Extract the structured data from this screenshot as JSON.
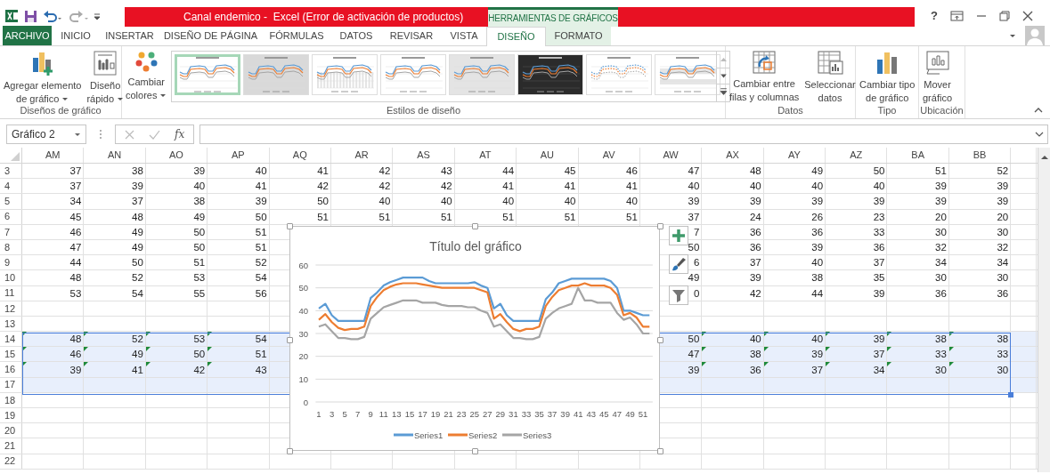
{
  "window": {
    "title": "Canal endemico -  Excel (Error de activación de productos)",
    "context_label": "HERRAMIENTAS DE GRÁFICOS",
    "help": "?"
  },
  "tabs": [
    {
      "label": "ARCHIVO",
      "kind": "file",
      "selected": false
    },
    {
      "label": "INICIO",
      "kind": "normal",
      "selected": false
    },
    {
      "label": "INSERTAR",
      "kind": "normal",
      "selected": false
    },
    {
      "label": "DISEÑO DE PÁGINA",
      "kind": "normal",
      "selected": false
    },
    {
      "label": "FÓRMULAS",
      "kind": "normal",
      "selected": false
    },
    {
      "label": "DATOS",
      "kind": "normal",
      "selected": false
    },
    {
      "label": "REVISAR",
      "kind": "normal",
      "selected": false
    },
    {
      "label": "VISTA",
      "kind": "normal",
      "selected": false
    },
    {
      "label": "DISEÑO",
      "kind": "context",
      "selected": true
    },
    {
      "label": "FORMATO",
      "kind": "context",
      "selected": false
    }
  ],
  "ribbon": {
    "groups": [
      {
        "label": "Diseños de gráfico",
        "buttons": [
          {
            "lines": [
              "Agregar elemento",
              "de gráfico"
            ],
            "dropdown": true
          },
          {
            "lines": [
              "Diseño",
              "rápido"
            ],
            "dropdown": true
          }
        ]
      },
      {
        "label": "Estilos de diseño",
        "buttons": [
          {
            "lines": [
              "Cambiar",
              "colores"
            ],
            "dropdown": true
          }
        ],
        "gallery": [
          {
            "kind": "plain",
            "selected": true
          },
          {
            "kind": "shaded",
            "selected": false
          },
          {
            "kind": "columns",
            "selected": false
          },
          {
            "kind": "plain",
            "selected": false
          },
          {
            "kind": "hatched",
            "selected": false
          },
          {
            "kind": "dark",
            "selected": false
          },
          {
            "kind": "markers",
            "selected": false
          },
          {
            "kind": "banded",
            "selected": false
          }
        ]
      },
      {
        "label": "Datos",
        "buttons": [
          {
            "lines": [
              "Cambiar entre",
              "filas y columnas"
            ],
            "dropdown": false
          },
          {
            "lines": [
              "Seleccionar",
              "datos"
            ],
            "dropdown": false
          }
        ]
      },
      {
        "label": "Tipo",
        "buttons": [
          {
            "lines": [
              "Cambiar tipo",
              "de gráfico"
            ],
            "dropdown": false
          }
        ]
      },
      {
        "label": "Ubicación",
        "buttons": [
          {
            "lines": [
              "Mover",
              "gráfico"
            ],
            "dropdown": false
          }
        ]
      }
    ]
  },
  "formula_bar": {
    "name_box": "Gráfico 2",
    "function_label": "fx"
  },
  "sheet": {
    "columns": [
      "AM",
      "AN",
      "AO",
      "AP",
      "AQ",
      "AR",
      "AS",
      "AT",
      "AU",
      "AV",
      "AW",
      "AX",
      "AY",
      "AZ",
      "BA",
      "BB"
    ],
    "rows": [
      {
        "number": "3",
        "selected": false,
        "flagged": false,
        "cells": [
          "37",
          "38",
          "39",
          "40",
          "41",
          "42",
          "43",
          "44",
          "45",
          "46",
          "47",
          "48",
          "49",
          "50",
          "51",
          "52"
        ]
      },
      {
        "number": "4",
        "selected": false,
        "flagged": false,
        "cells": [
          "37",
          "39",
          "40",
          "41",
          "42",
          "42",
          "42",
          "41",
          "41",
          "41",
          "40",
          "40",
          "40",
          "40",
          "39",
          "39"
        ]
      },
      {
        "number": "5",
        "selected": false,
        "flagged": false,
        "cells": [
          "34",
          "37",
          "38",
          "39",
          "50",
          "40",
          "40",
          "40",
          "40",
          "40",
          "39",
          "39",
          "39",
          "39",
          "39",
          "39"
        ]
      },
      {
        "number": "6",
        "selected": false,
        "flagged": false,
        "cells": [
          "45",
          "48",
          "49",
          "50",
          "51",
          "51",
          "51",
          "51",
          "51",
          "51",
          "37",
          "24",
          "26",
          "23",
          "20",
          "20"
        ]
      },
      {
        "number": "7",
        "selected": false,
        "flagged": false,
        "cells": [
          "46",
          "49",
          "50",
          "51",
          null,
          null,
          null,
          null,
          null,
          null,
          "7",
          "36",
          "36",
          "33",
          "30",
          "30"
        ]
      },
      {
        "number": "8",
        "selected": false,
        "flagged": false,
        "cells": [
          "47",
          "49",
          "50",
          "51",
          null,
          null,
          null,
          null,
          null,
          null,
          "50",
          "36",
          "39",
          "36",
          "32",
          "32"
        ]
      },
      {
        "number": "9",
        "selected": false,
        "flagged": false,
        "cells": [
          "44",
          "50",
          "51",
          "52",
          null,
          null,
          null,
          null,
          null,
          null,
          "6",
          "37",
          "40",
          "37",
          "34",
          "34"
        ]
      },
      {
        "number": "10",
        "selected": false,
        "flagged": false,
        "cells": [
          "48",
          "52",
          "53",
          "54",
          null,
          null,
          null,
          null,
          null,
          null,
          "49",
          "39",
          "38",
          "35",
          "30",
          "30"
        ]
      },
      {
        "number": "11",
        "selected": false,
        "flagged": false,
        "cells": [
          "53",
          "54",
          "55",
          "56",
          null,
          null,
          null,
          null,
          null,
          null,
          "0",
          "42",
          "44",
          "39",
          "36",
          "36"
        ]
      },
      {
        "number": "12",
        "selected": false,
        "flagged": false
      },
      {
        "number": "13",
        "selected": false,
        "flagged": false
      },
      {
        "number": "14",
        "selected": true,
        "flagged": true,
        "cells": [
          "48",
          "52",
          "53",
          "54",
          null,
          null,
          null,
          null,
          null,
          null,
          "50",
          "40",
          "40",
          "39",
          "38",
          "38"
        ]
      },
      {
        "number": "15",
        "selected": true,
        "flagged": true,
        "cells": [
          "46",
          "49",
          "50",
          "51",
          null,
          null,
          null,
          null,
          null,
          null,
          "47",
          "38",
          "39",
          "37",
          "33",
          "33"
        ]
      },
      {
        "number": "16",
        "selected": true,
        "flagged": true,
        "cells": [
          "39",
          "41",
          "42",
          "43",
          null,
          null,
          null,
          null,
          null,
          null,
          "39",
          "36",
          "37",
          "34",
          "30",
          "30"
        ]
      },
      {
        "number": "17",
        "selected": true,
        "flagged": false
      },
      {
        "number": "18",
        "selected": false,
        "flagged": false
      },
      {
        "number": "19",
        "selected": false,
        "flagged": false
      },
      {
        "number": "20",
        "selected": false,
        "flagged": false
      },
      {
        "number": "21",
        "selected": false,
        "flagged": false
      },
      {
        "number": "22",
        "selected": false,
        "flagged": false
      }
    ]
  },
  "chart": {
    "chart_data": {
      "type": "line",
      "title": "Título del gráfico",
      "x": [
        1,
        2,
        3,
        4,
        5,
        6,
        7,
        8,
        9,
        10,
        11,
        12,
        13,
        14,
        15,
        16,
        17,
        18,
        19,
        20,
        21,
        22,
        23,
        24,
        25,
        26,
        27,
        28,
        29,
        30,
        31,
        32,
        33,
        34,
        35,
        36,
        37,
        38,
        39,
        40,
        41,
        42,
        43,
        44,
        45,
        46,
        47,
        48,
        49,
        50,
        51,
        52
      ],
      "xticks": [
        1,
        3,
        5,
        7,
        9,
        11,
        13,
        15,
        17,
        19,
        21,
        23,
        25,
        27,
        29,
        31,
        33,
        35,
        37,
        39,
        41,
        43,
        45,
        47,
        49,
        51
      ],
      "xlim": [
        0.5,
        52.5
      ],
      "ylim": [
        0,
        60
      ],
      "yticks": [
        0,
        10,
        20,
        30,
        40,
        50,
        60
      ],
      "grid": true,
      "legend": "bottom",
      "series": [
        {
          "name": "Series1",
          "color": "#5b9bd5",
          "values": [
            41,
            43,
            38,
            35.5,
            35.5,
            35.5,
            35.5,
            35.5,
            45.5,
            48,
            51,
            52.5,
            53.5,
            54.5,
            54.5,
            54.5,
            54.5,
            53,
            52,
            52,
            52,
            52,
            52,
            52,
            52.5,
            51,
            50,
            41,
            43,
            38,
            35.5,
            35.5,
            35.5,
            35.5,
            35.5,
            45,
            48,
            52,
            53,
            54,
            54,
            54,
            54,
            54,
            54,
            53,
            50,
            40,
            40,
            39,
            38,
            38
          ]
        },
        {
          "name": "Series2",
          "color": "#ed7d31",
          "values": [
            36,
            38.5,
            35,
            32.5,
            31.5,
            32,
            32,
            33,
            42,
            46,
            49,
            50.5,
            51.5,
            52,
            52,
            52,
            51.5,
            51,
            50.5,
            50,
            50,
            50,
            50,
            50,
            50,
            49,
            48,
            36.5,
            38.5,
            35,
            32,
            31,
            32,
            32,
            33,
            42,
            46,
            49,
            50,
            51,
            51,
            52,
            51,
            51,
            51,
            50,
            47,
            38,
            39,
            37,
            33,
            33
          ]
        },
        {
          "name": "Series3",
          "color": "#a5a5a5",
          "values": [
            33,
            34,
            31,
            28,
            28,
            27.5,
            27.5,
            28.5,
            36.5,
            39,
            41.5,
            42.5,
            43.5,
            44.5,
            44.5,
            44.5,
            43.5,
            43.5,
            43.5,
            42.5,
            42,
            42,
            42,
            41.5,
            41.5,
            40,
            39,
            33,
            34,
            31,
            28,
            28,
            27.5,
            27.5,
            28.5,
            36.5,
            39,
            41,
            42,
            43,
            50,
            44.5,
            44.5,
            43.5,
            43.5,
            43.5,
            39,
            36,
            37,
            34,
            30,
            30
          ]
        }
      ]
    }
  }
}
